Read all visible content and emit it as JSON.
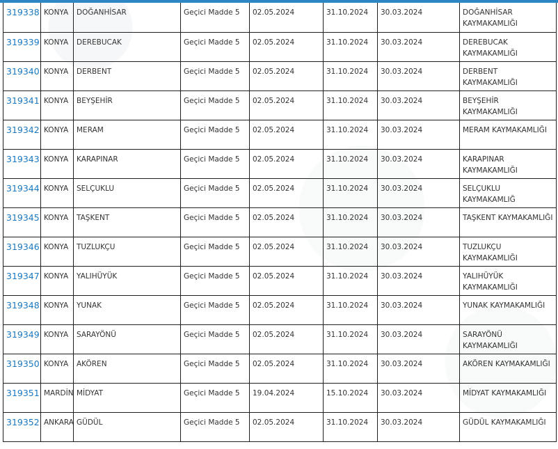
{
  "rows": [
    {
      "id": "319338",
      "province": "KONYA",
      "district": "DOĞANHİSAR",
      "article": "Geçici Madde 5",
      "start": "02.05.2024",
      "end": "31.10.2024",
      "date": "30.03.2024",
      "office": "DOĞANHİSAR KAYMAKAMLIĞI"
    },
    {
      "id": "319339",
      "province": "KONYA",
      "district": "DEREBUCAK",
      "article": "Geçici Madde 5",
      "start": "02.05.2024",
      "end": "31.10.2024",
      "date": "30.03.2024",
      "office": "DEREBUCAK KAYMAKAMLIĞI"
    },
    {
      "id": "319340",
      "province": "KONYA",
      "district": "DERBENT",
      "article": "Geçici Madde 5",
      "start": "02.05.2024",
      "end": "31.10.2024",
      "date": "30.03.2024",
      "office": "DERBENT KAYMAKAMLIĞI"
    },
    {
      "id": "319341",
      "province": "KONYA",
      "district": "BEYŞEHİR",
      "article": "Geçici Madde 5",
      "start": "02.05.2024",
      "end": "31.10.2024",
      "date": "30.03.2024",
      "office": "BEYŞEHİR KAYMAKAMLIĞI"
    },
    {
      "id": "319342",
      "province": "KONYA",
      "district": "MERAM",
      "article": "Geçici Madde 5",
      "start": "02.05.2024",
      "end": "31.10.2024",
      "date": "30.03.2024",
      "office": "MERAM KAYMAKAMLIĞI"
    },
    {
      "id": "319343",
      "province": "KONYA",
      "district": "KARAPINAR",
      "article": "Geçici Madde 5",
      "start": "02.05.2024",
      "end": "31.10.2024",
      "date": "30.03.2024",
      "office": "KARAPINAR KAYMAKAMLIĞI"
    },
    {
      "id": "319344",
      "province": "KONYA",
      "district": "SELÇUKLU",
      "article": "Geçici Madde 5",
      "start": "02.05.2024",
      "end": "31.10.2024",
      "date": "30.03.2024",
      "office": "SELÇUKLU KAYMAKAMLIĞ"
    },
    {
      "id": "319345",
      "province": "KONYA",
      "district": "TAŞKENT",
      "article": "Geçici Madde 5",
      "start": "02.05.2024",
      "end": "31.10.2024",
      "date": "30.03.2024",
      "office": "TAŞKENT KAYMAKAMLIĞI"
    },
    {
      "id": "319346",
      "province": "KONYA",
      "district": "TUZLUKÇU",
      "article": "Geçici Madde 5",
      "start": "02.05.2024",
      "end": "31.10.2024",
      "date": "30.03.2024",
      "office": "TUZLUKÇU KAYMAKAMLIĞI"
    },
    {
      "id": "319347",
      "province": "KONYA",
      "district": "YALIHÜYÜK",
      "article": "Geçici Madde 5",
      "start": "02.05.2024",
      "end": "31.10.2024",
      "date": "30.03.2024",
      "office": "YALIHÜYÜK KAYMAKAMLIĞI"
    },
    {
      "id": "319348",
      "province": "KONYA",
      "district": "YUNAK",
      "article": "Geçici Madde 5",
      "start": "02.05.2024",
      "end": "31.10.2024",
      "date": "30.03.2024",
      "office": "YUNAK KAYMAKAMLIĞI"
    },
    {
      "id": "319349",
      "province": "KONYA",
      "district": "SARAYÖNÜ",
      "article": "Geçici Madde 5",
      "start": "02.05.2024",
      "end": "31.10.2024",
      "date": "30.03.2024",
      "office": "SARAYÖNÜ KAYMAKAMLIĞI"
    },
    {
      "id": "319350",
      "province": "KONYA",
      "district": "AKÖREN",
      "article": "Geçici Madde 5",
      "start": "02.05.2024",
      "end": "31.10.2024",
      "date": "30.03.2024",
      "office": "AKÖREN KAYMAKAMLIĞI"
    },
    {
      "id": "319351",
      "province": "MARDİN",
      "district": "MİDYAT",
      "article": "Geçici Madde 5",
      "start": "19.04.2024",
      "end": "15.10.2024",
      "date": "30.03.2024",
      "office": "MİDYAT KAYMAKAMLIĞI"
    },
    {
      "id": "319352",
      "province": "ANKARA",
      "district": "GÜDÜL",
      "article": "Geçici Madde 5",
      "start": "02.05.2024",
      "end": "31.10.2024",
      "date": "30.03.2024",
      "office": "GÜDÜL KAYMAKAMLIĞI"
    }
  ]
}
